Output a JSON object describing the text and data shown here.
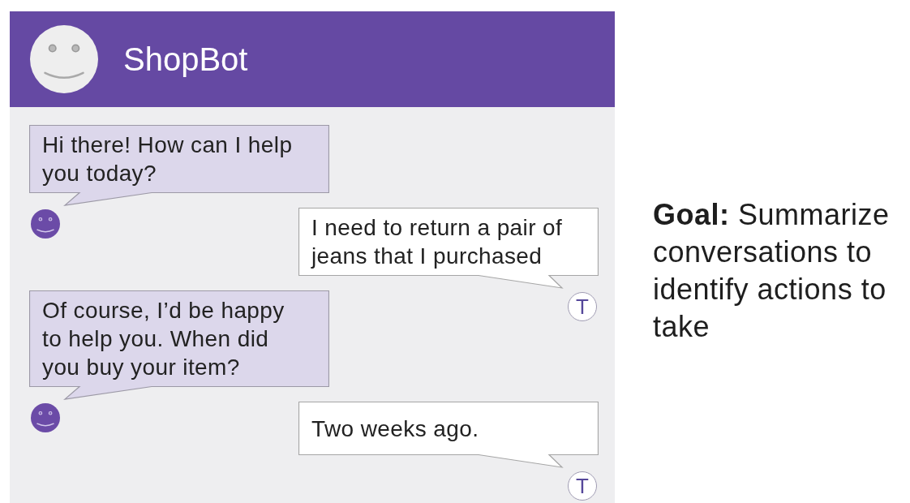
{
  "header": {
    "title": "ShopBot"
  },
  "messages": [
    {
      "kind": "bot",
      "text": "Hi there! How can I help you today?"
    },
    {
      "kind": "user",
      "text": "I need to return a pair of jeans that I purchased",
      "avatar_letter": "T"
    },
    {
      "kind": "bot",
      "text": "Of course, I’d be happy to help you. When did you buy your item?"
    },
    {
      "kind": "user",
      "text": "Two weeks ago.",
      "avatar_letter": "T"
    }
  ],
  "goal": {
    "text": "**Goal:** Summarize conversations to identify actions to take"
  }
}
